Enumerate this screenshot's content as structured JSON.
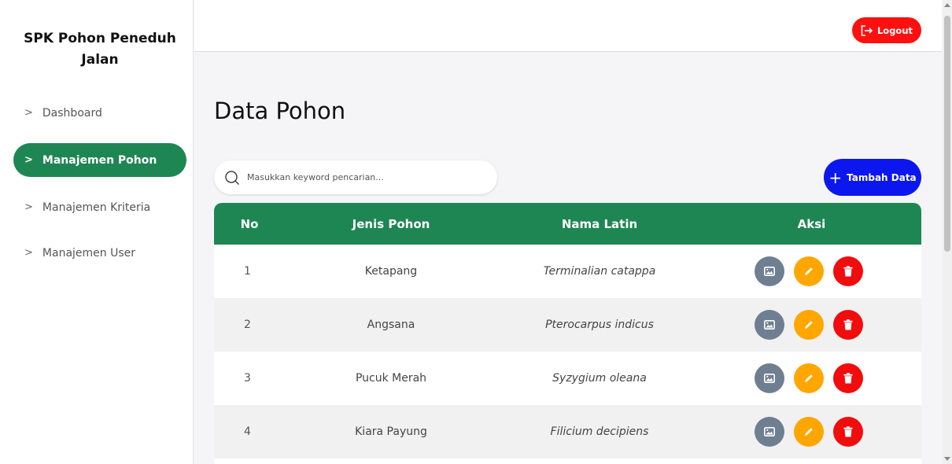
{
  "sidebar": {
    "brand": "SPK Pohon Peneduh Jalan",
    "items": [
      {
        "label": "Dashboard"
      },
      {
        "label": "Manajemen Pohon"
      },
      {
        "label": "Manajemen Kriteria"
      },
      {
        "label": "Manajemen User"
      }
    ],
    "active_index": 1
  },
  "topbar": {
    "logout_label": "Logout"
  },
  "main": {
    "title": "Data Pohon",
    "search": {
      "placeholder": "Masukkan keyword pencarian...",
      "value": ""
    },
    "add_label": "Tambah Data",
    "table": {
      "headers": [
        "No",
        "Jenis Pohon",
        "Nama Latin",
        "Aksi"
      ],
      "rows": [
        {
          "no": "1",
          "jenis": "Ketapang",
          "latin": "Terminalian catappa"
        },
        {
          "no": "2",
          "jenis": "Angsana",
          "latin": "Pterocarpus indicus"
        },
        {
          "no": "3",
          "jenis": "Pucuk Merah",
          "latin": "Syzygium oleana"
        },
        {
          "no": "4",
          "jenis": "Kiara Payung",
          "latin": "Filicium decipiens"
        }
      ]
    }
  },
  "colors": {
    "primary_green": "#1e8653",
    "logout_red": "#ff1010",
    "add_blue": "#0b17ee",
    "view_gray": "#6f7f91",
    "edit_orange": "#ffa600",
    "delete_red": "#f10d0d"
  },
  "icons": {
    "nav": "chevron-right-icon",
    "logout": "logout-icon",
    "search": "search-icon",
    "add": "plus-icon",
    "view": "image-icon",
    "edit": "pencil-icon",
    "delete": "trash-icon"
  }
}
